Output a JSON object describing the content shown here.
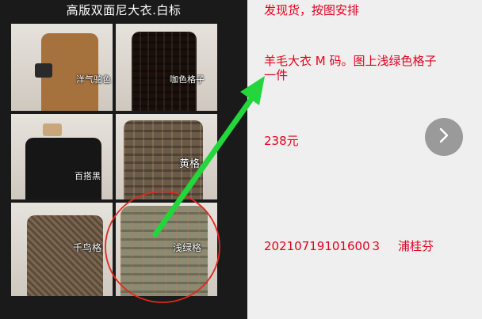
{
  "photo": {
    "title": "高版双面尼大衣.白标",
    "tiles": [
      {
        "label": "洋气驼色"
      },
      {
        "label": "咖色格子"
      },
      {
        "label": "百搭黑"
      },
      {
        "label": "黄格"
      },
      {
        "label": "千鸟格"
      },
      {
        "label": "浅绿格"
      }
    ]
  },
  "message": {
    "line1": "发现货，按图安排",
    "line2a": "羊毛大衣 M 码。图上浅绿色格子",
    "line2b": "一件",
    "price": "238元",
    "order": "20210719101600３",
    "name": "浦桂芬"
  },
  "colors": {
    "text_red": "#e4001c",
    "arrow_green": "#22d63c",
    "circle_red": "#e0281e",
    "next_button_bg": "#9a9a9a"
  },
  "icons": {
    "next": "chevron-right-icon"
  }
}
